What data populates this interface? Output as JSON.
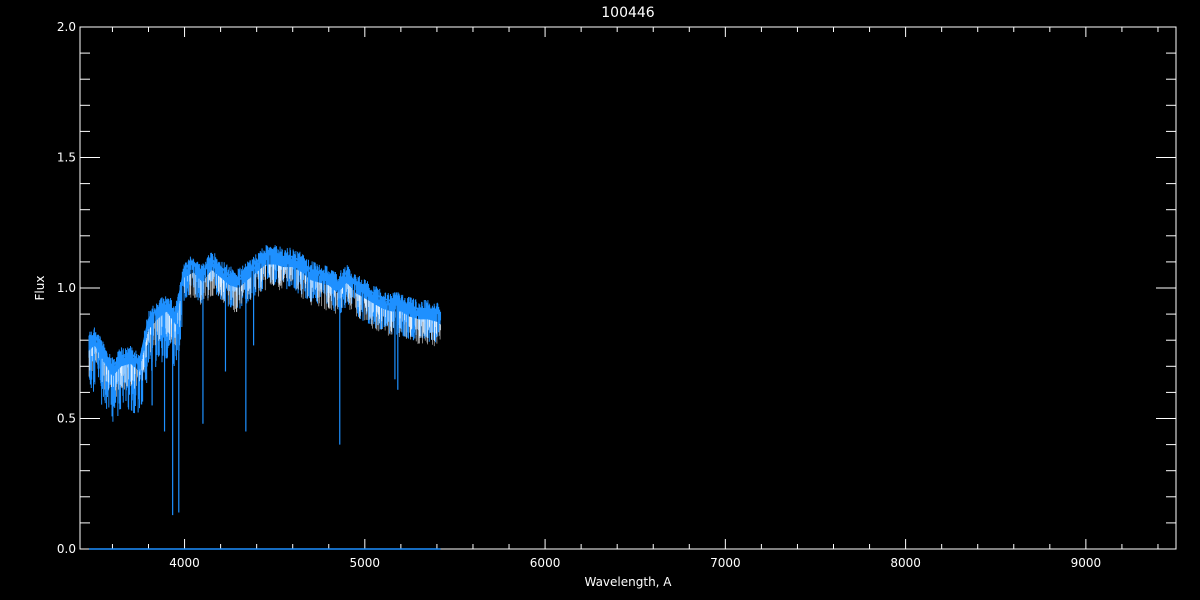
{
  "chart_data": {
    "type": "line",
    "title": "100446",
    "xlabel": "Wavelength, A",
    "ylabel": "Flux",
    "xlim": [
      3420,
      9500
    ],
    "ylim": [
      0.0,
      2.0
    ],
    "x_ticks": [
      4000,
      5000,
      6000,
      7000,
      8000,
      9000
    ],
    "x_tick_labels": [
      "4000",
      "5000",
      "6000",
      "7000",
      "8000",
      "9000"
    ],
    "x_minor_step": 200,
    "y_ticks": [
      0.0,
      0.5,
      1.0,
      1.5,
      2.0
    ],
    "y_tick_labels": [
      "0.0",
      "0.5",
      "1.0",
      "1.5",
      "2.0"
    ],
    "y_minor_step": 0.1,
    "grid": false,
    "background": "#000000",
    "axis_color": "#ffffff",
    "series": [
      {
        "color": "#1e90ff",
        "x": [
          3470,
          3500,
          3550,
          3600,
          3650,
          3700,
          3750,
          3800,
          3850,
          3900,
          3950,
          4000,
          4050,
          4100,
          4150,
          4200,
          4250,
          4300,
          4350,
          4400,
          4450,
          4500,
          4550,
          4600,
          4650,
          4700,
          4750,
          4800,
          4850,
          4900,
          4950,
          5000,
          5050,
          5100,
          5150,
          5200,
          5250,
          5300,
          5350,
          5400,
          5420
        ],
        "y": [
          0.8,
          0.82,
          0.76,
          0.7,
          0.74,
          0.75,
          0.72,
          0.88,
          0.92,
          0.95,
          0.9,
          1.08,
          1.1,
          1.06,
          1.11,
          1.08,
          1.05,
          1.04,
          1.07,
          1.1,
          1.13,
          1.13,
          1.12,
          1.12,
          1.1,
          1.07,
          1.06,
          1.05,
          1.02,
          1.06,
          1.02,
          1.0,
          0.98,
          0.96,
          0.95,
          0.95,
          0.93,
          0.92,
          0.92,
          0.91,
          0.9
        ],
        "absorption_lines": [
          {
            "x": 3820,
            "y": 0.55
          },
          {
            "x": 3889,
            "y": 0.45
          },
          {
            "x": 3934,
            "y": 0.13
          },
          {
            "x": 3968,
            "y": 0.14
          },
          {
            "x": 4102,
            "y": 0.48
          },
          {
            "x": 4227,
            "y": 0.68
          },
          {
            "x": 4340,
            "y": 0.45
          },
          {
            "x": 4383,
            "y": 0.78
          },
          {
            "x": 4861,
            "y": 0.4
          },
          {
            "x": 5167,
            "y": 0.65
          },
          {
            "x": 5183,
            "y": 0.61
          },
          {
            "x": 5270,
            "y": 0.8
          }
        ],
        "baseline_x": [
          3470,
          5420
        ],
        "baseline_y": 0.0
      }
    ]
  }
}
